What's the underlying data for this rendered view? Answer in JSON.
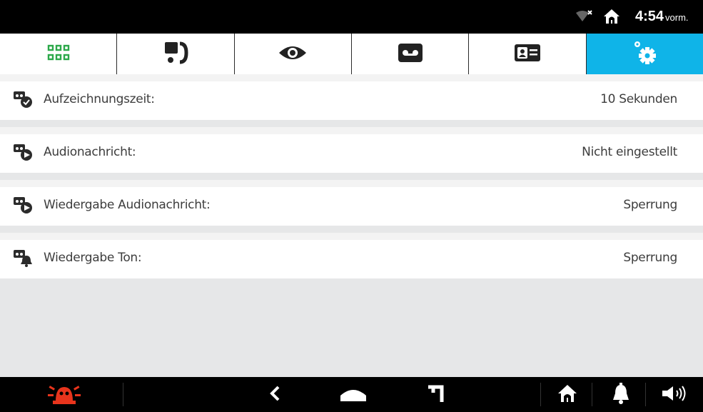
{
  "status": {
    "time": "4:54",
    "ampm": "vorm."
  },
  "tabs": [
    {
      "icon": "apps-grid-icon",
      "active": false
    },
    {
      "icon": "intercom-icon",
      "active": false
    },
    {
      "icon": "eye-icon",
      "active": false
    },
    {
      "icon": "voicemail-icon",
      "active": false
    },
    {
      "icon": "contact-card-icon",
      "active": false
    },
    {
      "icon": "settings-gear-icon",
      "active": true
    }
  ],
  "settings": [
    {
      "icon": "record-time-icon",
      "label": "Aufzeichnungszeit:",
      "value": "10 Sekunden"
    },
    {
      "icon": "audio-message-icon",
      "label": "Audionachricht:",
      "value": "Nicht eingestellt"
    },
    {
      "icon": "play-audio-message-icon",
      "label": "Wiedergabe Audionachricht:",
      "value": "Sperrung"
    },
    {
      "icon": "play-tone-icon",
      "label": "Wiedergabe Ton:",
      "value": "Sperrung"
    }
  ],
  "colors": {
    "accent": "#0fb4e8",
    "alarm": "#e8341c",
    "apps_green": "#2ca84a"
  }
}
